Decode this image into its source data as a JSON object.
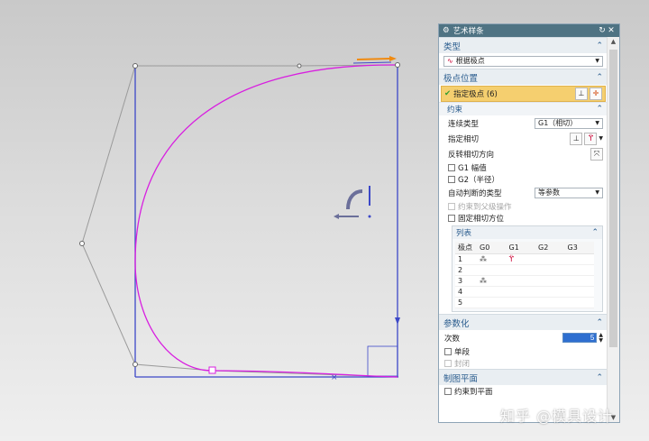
{
  "window": {
    "title": "艺术样条",
    "gear_icon": "gear-icon",
    "reset_icon": "refresh-icon",
    "close_icon": "close-icon"
  },
  "type_section": {
    "title": "类型",
    "selected": "根据极点"
  },
  "pole_section": {
    "title": "极点位置",
    "specify_pole": "指定极点 (6)",
    "constraint_title": "约束",
    "continuity_label": "连续类型",
    "continuity_value": "G1（相切）",
    "specify_tangent": "指定相切",
    "reverse_tangent": "反转相切方向",
    "g1_magnitude": "G1 幅值",
    "g2_radius": "G2（半径）",
    "auto_judge_label": "自动判断的类型",
    "auto_judge_value": "等参数",
    "constrain_to_parent": "约束到父级操作",
    "fix_tangent": "固定相切方位",
    "list": {
      "title": "列表",
      "headers": [
        "极点",
        "G0",
        "G1",
        "G2",
        "G3"
      ],
      "rows": [
        {
          "id": "1",
          "g0": "⁂",
          "g1": "ϔ",
          "g2": "",
          "g3": ""
        },
        {
          "id": "2",
          "g0": "",
          "g1": "",
          "g2": "",
          "g3": ""
        },
        {
          "id": "3",
          "g0": "⁂",
          "g1": "",
          "g2": "",
          "g3": ""
        },
        {
          "id": "4",
          "g0": "",
          "g1": "",
          "g2": "",
          "g3": ""
        },
        {
          "id": "5",
          "g0": "",
          "g1": "",
          "g2": "",
          "g3": ""
        }
      ]
    }
  },
  "param_section": {
    "title": "参数化",
    "degree_label": "次数",
    "degree_value": "5",
    "single_segment": "单段",
    "closed": "封闭"
  },
  "plane_section": {
    "title": "制图平面",
    "constrain_to_plane": "约束到平面"
  },
  "watermark": "知乎 @模具设计",
  "colors": {
    "curve": "#d81ee0",
    "frame": "#3c48c8",
    "poly": "#9a9a9a",
    "accent": "#f5cf6f",
    "header": "#4f7383"
  }
}
